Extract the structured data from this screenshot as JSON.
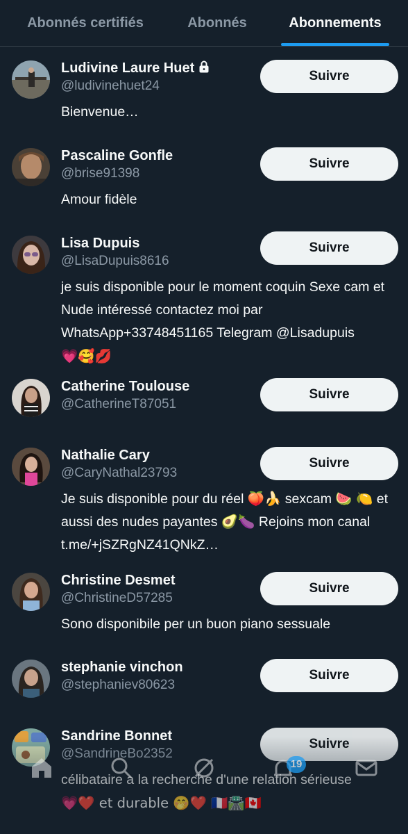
{
  "tabs": [
    {
      "label": "Abonnés certifiés"
    },
    {
      "label": "Abonnés"
    },
    {
      "label": "Abonnements",
      "active": true
    }
  ],
  "follow_label": "Suivre",
  "users": [
    {
      "name": "Ludivine Laure Huet",
      "handle": "@ludivinehuet24",
      "bio": "Bienvenue…",
      "protected": true
    },
    {
      "name": "Pascaline Gonfle",
      "handle": "@brise91398",
      "bio": "Amour fidèle"
    },
    {
      "name": "Lisa Dupuis",
      "handle": "@LisaDupuis8616",
      "bio": "je suis disponible pour le moment coquin Sexe cam et Nude intéressé contactez moi par WhatsApp+33748451165 Telegram @Lisadupuis",
      "bio_emoji": "💗🥰💋"
    },
    {
      "name": "Catherine Toulouse",
      "handle": "@CatherineT87051",
      "bio": ""
    },
    {
      "name": "Nathalie Cary",
      "handle": "@CaryNathal23793",
      "bio": "Je suis disponible pour du réel 🍑🍌 sexcam 🍉 🍋 et aussi des nudes payantes 🥑🍆 Rejoins mon canal t.me/+jSZRgNZ41QNkZ…"
    },
    {
      "name": "Christine Desmet",
      "handle": "@ChristineD57285",
      "bio": "Sono disponibile per un buon piano sessuale"
    },
    {
      "name": "stephanie vinchon",
      "handle": "@stephaniev80623",
      "bio": ""
    },
    {
      "name": "Sandrine Bonnet",
      "handle": "@SandrineBo2352",
      "bio": "célibataire a la recherche d'une relation sérieuse",
      "bio_line2": "💗❤️ et durable 🤭❤️ 🇫🇷🛣️🇨🇦"
    }
  ],
  "nav": {
    "notifications_badge": "19",
    "icons": [
      "home-icon",
      "search-icon",
      "grok-icon",
      "notifications-icon",
      "messages-icon"
    ]
  },
  "colors": {
    "background": "#15202b",
    "accent": "#1d9bf0",
    "secondary_text": "#8b98a5",
    "button_bg": "#eff3f4"
  }
}
